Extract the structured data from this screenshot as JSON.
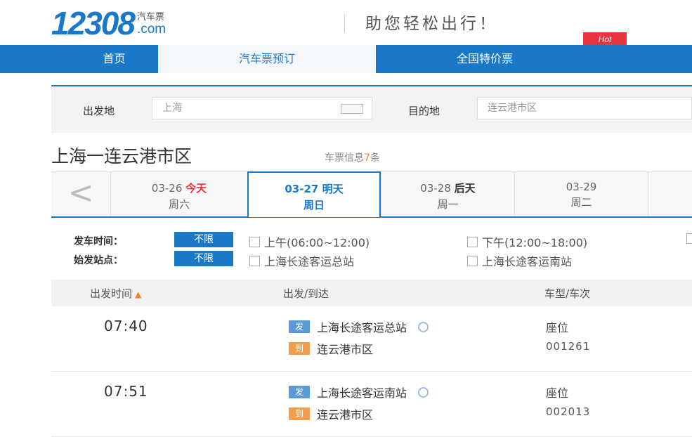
{
  "header": {
    "logo_main": "12308",
    "logo_cn": "汽车票",
    "logo_com": ".com",
    "slogan": "助您轻松出行！",
    "hot_badge": "Hot"
  },
  "nav": {
    "items": [
      {
        "label": "首页"
      },
      {
        "label": "汽车票预订"
      },
      {
        "label": "全国特价票"
      }
    ]
  },
  "search": {
    "from_label": "出发地",
    "from_value": "上海",
    "to_label": "目的地",
    "to_value": "连云港市区"
  },
  "route": {
    "title": "上海一连云港市区",
    "count_prefix": "车票信息",
    "count": "7",
    "count_suffix": "条"
  },
  "date_tabs": [
    {
      "date": "03-26",
      "tag": "今天",
      "weekday": "周六"
    },
    {
      "date": "03-27",
      "tag": "明天",
      "weekday": "周日"
    },
    {
      "date": "03-28",
      "tag": "后天",
      "weekday": "周一"
    },
    {
      "date": "03-29",
      "tag": "",
      "weekday": "周二"
    }
  ],
  "filters": {
    "time_label": "发车时间：",
    "station_label": "始发站点：",
    "unlimited": "不限",
    "time_options": [
      "上午(06:00~12:00)",
      "下午(12:00~18:00)"
    ],
    "station_options": [
      "上海长途客运总站",
      "上海长途客运南站"
    ]
  },
  "table": {
    "headers": [
      "出发时间",
      "出发/到达",
      "车型/车次"
    ],
    "dep_badge": "发",
    "arr_badge": "到",
    "rows": [
      {
        "time": "07:40",
        "from": "上海长途客运总站",
        "to": "连云港市区",
        "type": "座位",
        "code": "001261"
      },
      {
        "time": "07:51",
        "from": "上海长途客运南站",
        "to": "连云港市区",
        "type": "座位",
        "code": "002013"
      }
    ]
  },
  "colors": {
    "brand_blue": "#1a78c8",
    "hot_red": "#e8343e",
    "accent_orange": "#f58220"
  }
}
